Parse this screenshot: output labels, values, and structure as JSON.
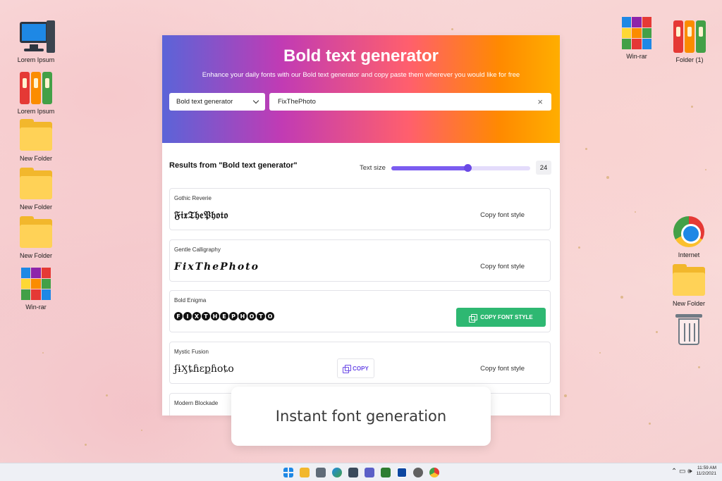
{
  "desktop": {
    "left_icons": [
      {
        "label": "Lorem Ipsum",
        "icon": "computer-icon"
      },
      {
        "label": "Lorem Ipsum",
        "icon": "binders-icon"
      },
      {
        "label": "New Folder",
        "icon": "folder-icon"
      },
      {
        "label": "New Folder",
        "icon": "folder-icon"
      },
      {
        "label": "New Folder",
        "icon": "folder-icon"
      },
      {
        "label": "Win-rar",
        "icon": "winrar-icon"
      }
    ],
    "right_icons": [
      {
        "label": "Win-rar",
        "icon": "winrar-icon"
      },
      {
        "label": "Folder (1)",
        "icon": "binders-icon"
      },
      {
        "label": "Internet",
        "icon": "chrome-icon"
      },
      {
        "label": "New Folder",
        "icon": "folder-icon"
      },
      {
        "label": "",
        "icon": "recycle-bin-icon"
      }
    ]
  },
  "app": {
    "title": "Bold text generator",
    "subtitle": "Enhance your daily fonts with our Bold text generator and copy paste them wherever you would like for free",
    "generator_select": "Bold text generator",
    "text_input_value": "FixThePhoto",
    "results_heading": "Results from \"Bold text generator\"",
    "text_size_label": "Text size",
    "text_size_value": "24",
    "text_size_fraction": 0.55,
    "copy_label": "Copy font style",
    "copy_button_label": "COPY FONT STYLE",
    "cards": [
      {
        "name": "Gothic Reverie",
        "sample": "𝔉𝔦𝔵𝔗𝔥𝔢𝔓𝔥𝔬𝔱𝔬"
      },
      {
        "name": "Gentle Calligraphy",
        "sample": "𝑭𝒊𝒙𝑻𝒉𝒆𝑷𝒉𝒐𝒕𝒐"
      },
      {
        "name": "Bold Enigma",
        "sample": "FIXTHEPHOTO"
      },
      {
        "name": "Mystic Fusion",
        "sample": "ʄɨӼȶɦɛքɦօȶօ"
      },
      {
        "name": "Modern Blockade",
        "sample": ""
      }
    ],
    "mini_copy_label": "COPY"
  },
  "toast": {
    "text": "Instant font generation"
  },
  "taskbar": {
    "time": "11:59 AM",
    "date": "11/2/2021",
    "tray_glyphs": "⌃ ▭ 🕪"
  },
  "colors": {
    "accent": "#7b5cf0",
    "copy_green": "#2eb872",
    "hero_gradient": [
      "#5b64d8",
      "#c13bb4",
      "#ff5f6d",
      "#ff8a00",
      "#ffae00"
    ]
  }
}
